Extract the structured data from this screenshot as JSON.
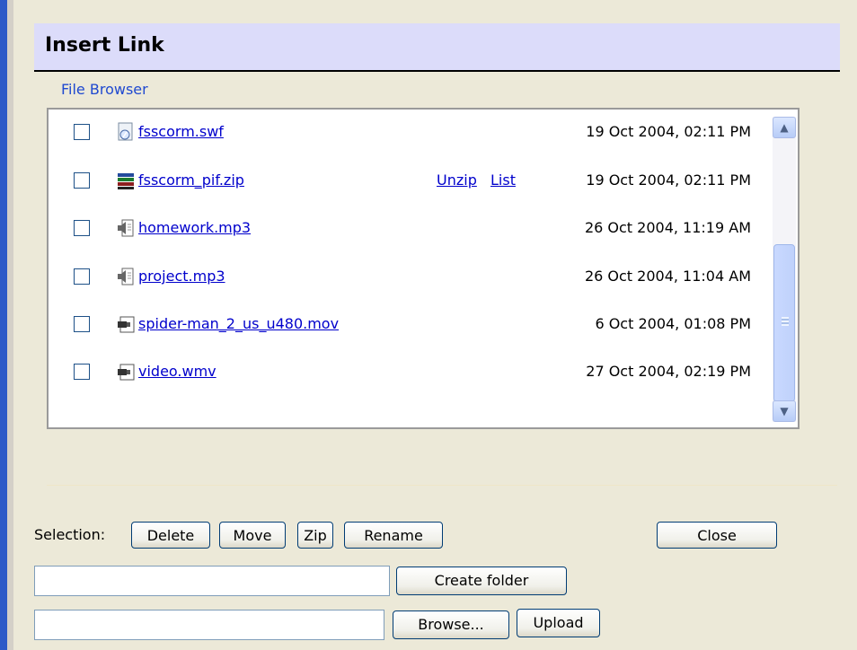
{
  "dialog": {
    "title": "Insert Link",
    "section": "File Browser"
  },
  "files": [
    {
      "name": "fsscorm.swf",
      "icon": "flash-file-icon",
      "date": "19 Oct 2004, 02:11 PM",
      "unzip": "",
      "list": ""
    },
    {
      "name": "fsscorm_pif.zip",
      "icon": "zip-archive-icon",
      "date": "19 Oct 2004, 02:11 PM",
      "unzip": "Unzip",
      "list": "List"
    },
    {
      "name": "homework.mp3",
      "icon": "audio-file-icon",
      "date": "26 Oct 2004, 11:19 AM",
      "unzip": "",
      "list": ""
    },
    {
      "name": "project.mp3",
      "icon": "audio-file-icon",
      "date": "26 Oct 2004, 11:04 AM",
      "unzip": "",
      "list": ""
    },
    {
      "name": "spider-man_2_us_u480.mov",
      "icon": "video-file-icon",
      "date": "6 Oct 2004, 01:08 PM",
      "unzip": "",
      "list": ""
    },
    {
      "name": "video.wmv",
      "icon": "video-file-icon",
      "date": "27 Oct 2004, 02:19 PM",
      "unzip": "",
      "list": ""
    }
  ],
  "actions": {
    "selection_label": "Selection:",
    "delete": "Delete",
    "move": "Move",
    "zip": "Zip",
    "rename": "Rename",
    "close": "Close",
    "create_folder": "Create folder",
    "browse": "Browse...",
    "upload": "Upload"
  },
  "inputs": {
    "folder_name_value": "",
    "upload_path_value": ""
  },
  "colors": {
    "title_bar": "#dcdcfa",
    "link": "#0000cc",
    "panel": "#ece9d8",
    "left_border": "#2d5ac8"
  }
}
